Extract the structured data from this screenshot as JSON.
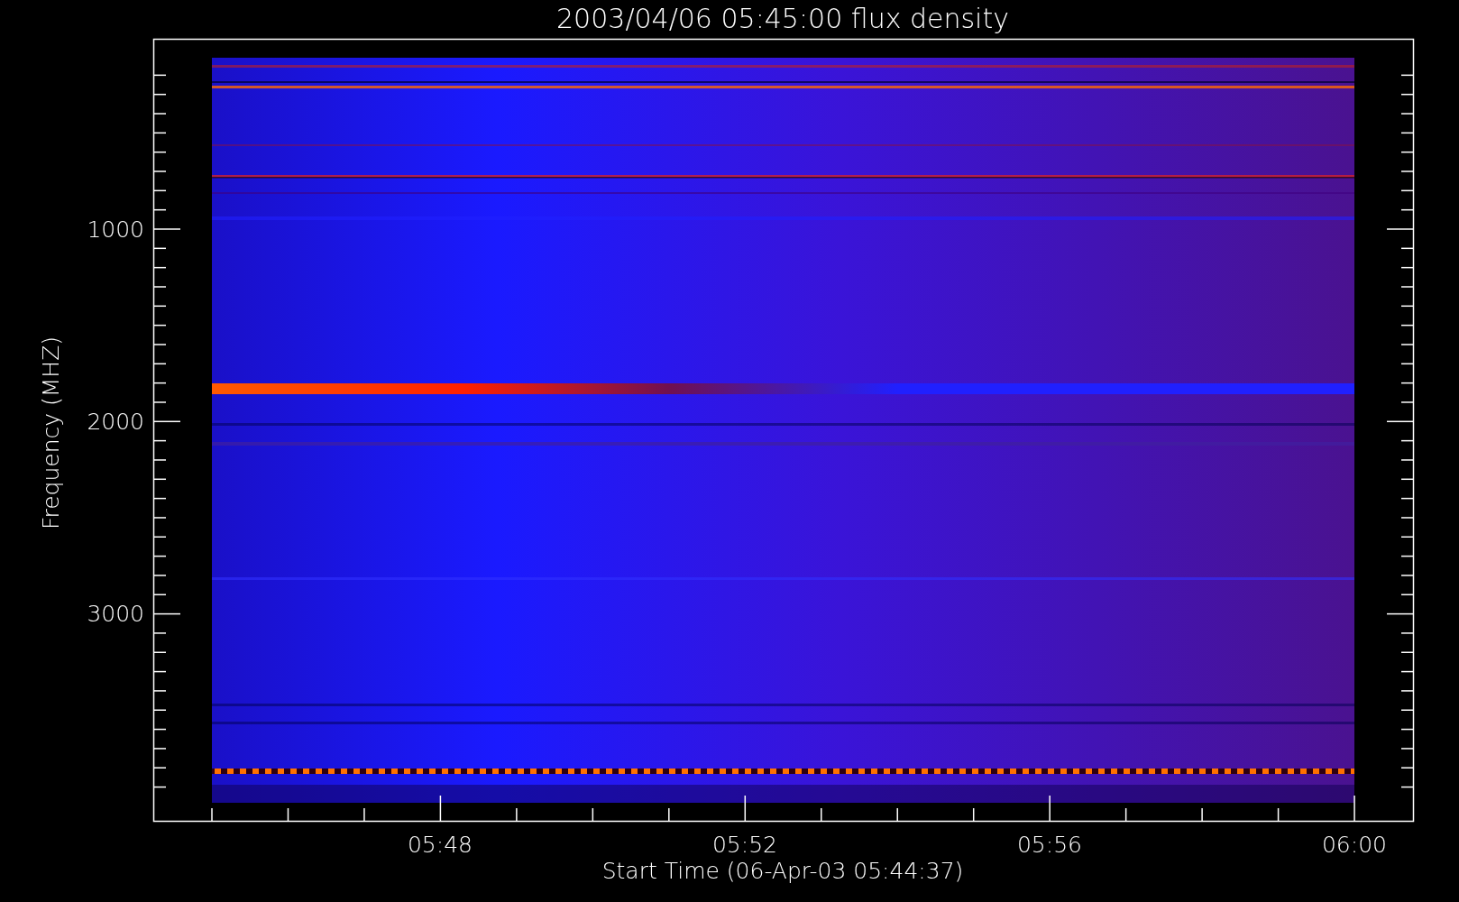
{
  "title": "2003/04/06 05:45:00 flux density",
  "y_axis": {
    "label": "Frequency (MHZ)",
    "ticks": [
      "1000",
      "2000",
      "3000"
    ]
  },
  "x_axis": {
    "label": "Start Time (06-Apr-03 05:44:37)",
    "ticks": [
      "05:48",
      "05:52",
      "05:56",
      "06:00"
    ]
  }
}
